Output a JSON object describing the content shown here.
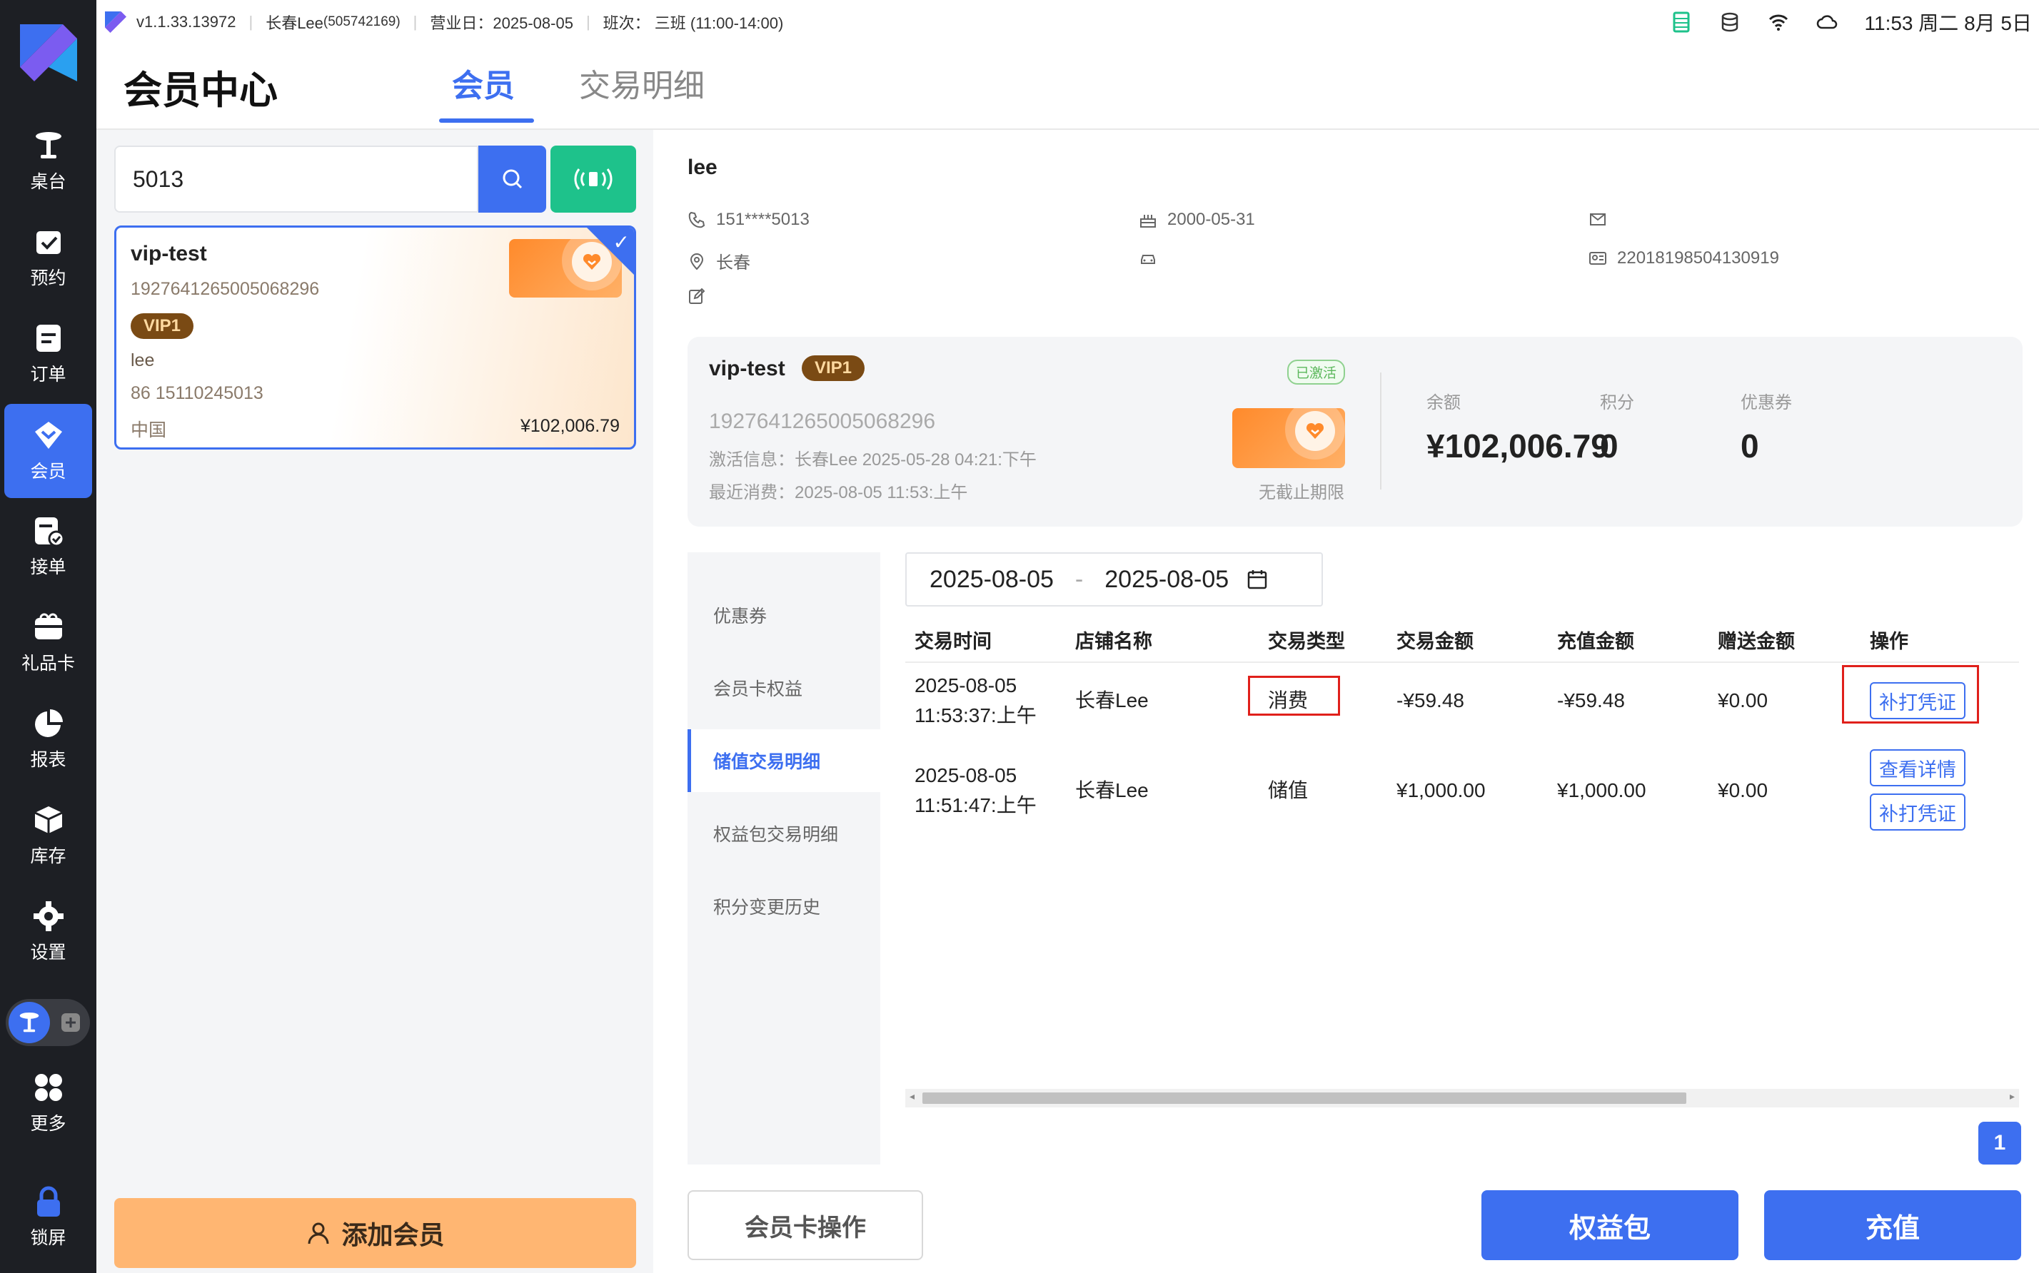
{
  "status": {
    "version": "v1.1.33.13972",
    "store": "长春Lee",
    "store_id": "(505742169)",
    "business_day": "营业日：2025-08-05",
    "shift": "班次：  三班 (11:00-14:00)",
    "time": "11:53 周二 8月 5日"
  },
  "sidebar": {
    "items": [
      {
        "label": "桌台"
      },
      {
        "label": "预约"
      },
      {
        "label": "订单"
      },
      {
        "label": "会员"
      },
      {
        "label": "接单"
      },
      {
        "label": "礼品卡"
      },
      {
        "label": "报表"
      },
      {
        "label": "库存"
      },
      {
        "label": "设置"
      },
      {
        "label": "更多"
      },
      {
        "label": "锁屏"
      }
    ]
  },
  "header": {
    "title": "会员中心",
    "tabs": [
      {
        "label": "会员"
      },
      {
        "label": "交易明细"
      }
    ]
  },
  "search": {
    "value": "5013"
  },
  "member_card": {
    "name": "vip-test",
    "number": "1927641265005068296",
    "level": "VIP1",
    "user": "lee",
    "phone": "86 15110245013",
    "country": "中国",
    "balance": "¥102,006.79"
  },
  "add_member": {
    "label": "添加会员"
  },
  "profile": {
    "name": "lee",
    "phone": "151****5013",
    "birthday": "2000-05-31",
    "city": "长春",
    "id_number": "22018198504130919"
  },
  "card_panel": {
    "name": "vip-test",
    "level": "VIP1",
    "status": "已激活",
    "number": "1927641265005068296",
    "activation": "激活信息：长春Lee  2025-05-28 04:21:下午",
    "last_spend": "最近消费：2025-08-05 11:53:上午",
    "expiry": "无截止期限",
    "balance_label": "余额",
    "balance": "¥102,006.79",
    "points_label": "积分",
    "points": "0",
    "coupons_label": "优惠券",
    "coupons": "0"
  },
  "side_tabs": [
    {
      "label": "优惠券"
    },
    {
      "label": "会员卡权益"
    },
    {
      "label": "储值交易明细"
    },
    {
      "label": "权益包交易明细"
    },
    {
      "label": "积分变更历史"
    }
  ],
  "date_range": {
    "start": "2025-08-05",
    "sep": "-",
    "end": "2025-08-05"
  },
  "table": {
    "headers": [
      "交易时间",
      "店铺名称",
      "交易类型",
      "交易金额",
      "充值金额",
      "赠送金额",
      "操作"
    ],
    "rows": [
      {
        "date": "2025-08-05",
        "time": "11:53:37:上午",
        "store": "长春Lee",
        "type": "消费",
        "amount": "-¥59.48",
        "recharge": "-¥59.48",
        "bonus": "¥0.00",
        "ops": [
          "补打凭证"
        ]
      },
      {
        "date": "2025-08-05",
        "time": "11:51:47:上午",
        "store": "长春Lee",
        "type": "储值",
        "amount": "¥1,000.00",
        "recharge": "¥1,000.00",
        "bonus": "¥0.00",
        "ops": [
          "查看详情",
          "补打凭证"
        ]
      }
    ]
  },
  "pager": {
    "page": "1"
  },
  "actions": {
    "card_ops": "会员卡操作",
    "benefits": "权益包",
    "recharge": "充值"
  },
  "colors": {
    "accent": "#3d6ff0",
    "green": "#1ec28b",
    "orange": "#ffb672",
    "highlight": "#e0201b"
  }
}
